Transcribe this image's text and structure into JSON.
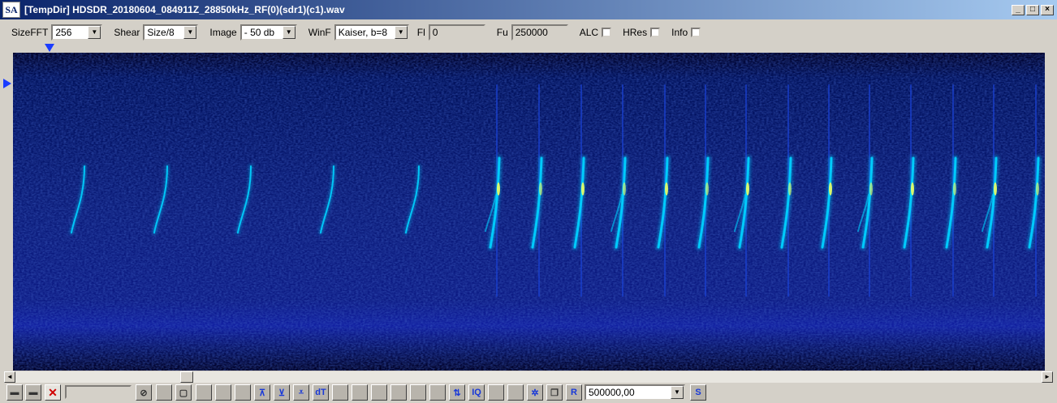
{
  "window": {
    "icon": "SA",
    "title": "[TempDir] HDSDR_20180604_084911Z_28850kHz_RF(0)(sdr1)(c1).wav"
  },
  "controls": {
    "sizefft_label": "SizeFFT",
    "sizefft_value": "256",
    "shear_label": "Shear",
    "shear_value": "Size/8",
    "image_label": "Image",
    "image_value": "- 50 db",
    "winf_label": "WinF",
    "winf_value": "Kaiser, b=8",
    "fl_label": "Fl",
    "fl_value": "0",
    "fu_label": "Fu",
    "fu_value": "250000",
    "alc_label": "ALC",
    "alc_checked": false,
    "hres_label": "HRes",
    "hres_checked": false,
    "info_label": "Info",
    "info_checked": false
  },
  "bottom": {
    "rate_value": "500000,00",
    "btn_dt": "dT",
    "btn_iq": "IQ",
    "btn_r": "R",
    "btn_s": "S"
  },
  "icons": [
    "open-icon",
    "save-icon",
    "close-red-x-icon",
    "stop-icon",
    "square-icon",
    "arrow-up-icon",
    "arrow-down-icon",
    "double-arrow-icon",
    "dt-icon",
    "iq-icon",
    "gear-icon",
    "r-icon",
    "s-icon"
  ],
  "colors": {
    "spectro_bg": "#00003a",
    "trace": "#00d0ff",
    "trace_peak": "#f0ff60",
    "title_start": "#0a246a"
  }
}
